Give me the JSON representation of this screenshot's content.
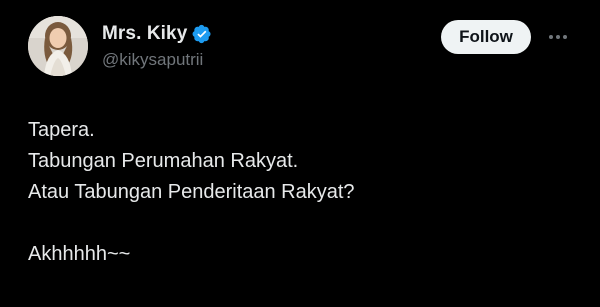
{
  "author": {
    "display_name": "Mrs. Kiky",
    "handle": "@kikysaputrii",
    "verified": true,
    "verified_color": "#1d9bf0"
  },
  "actions": {
    "follow_label": "Follow",
    "more_icon": "ellipsis-horizontal-icon"
  },
  "tweet": {
    "lines": [
      "Tapera.",
      "Tabungan Perumahan Rakyat.",
      "Atau Tabungan Penderitaan Rakyat?",
      "",
      "Akhhhhh~~"
    ]
  },
  "colors": {
    "background": "#000000",
    "text_primary": "#e7e9ea",
    "text_secondary": "#71767b",
    "button_bg": "#eff3f4",
    "button_text": "#0f1419"
  }
}
